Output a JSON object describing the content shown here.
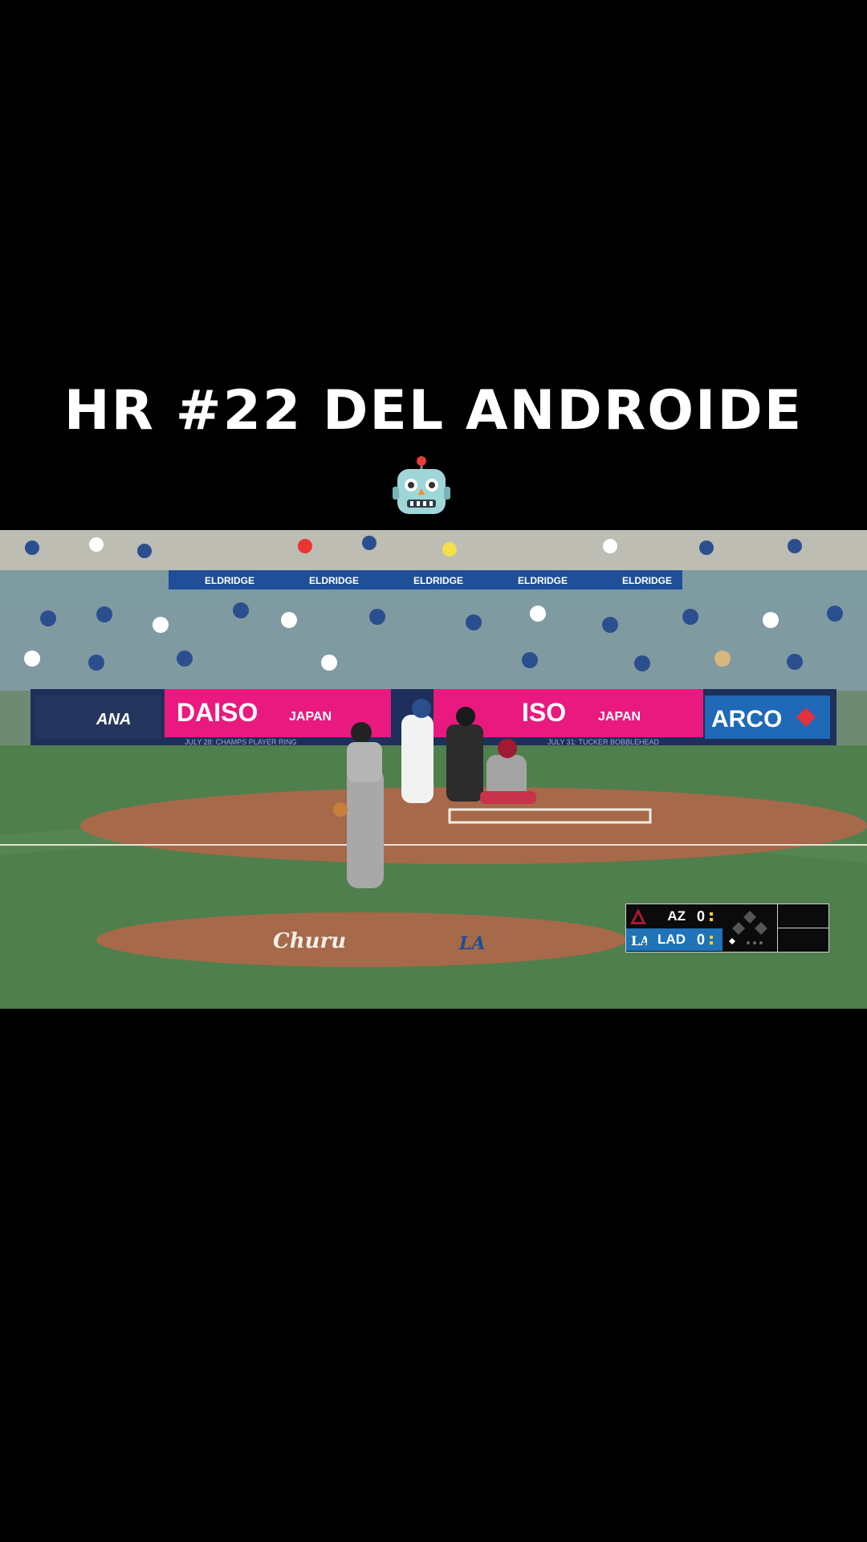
{
  "caption": {
    "title": "HR #22 DEL ANDROIDE",
    "emoji_icon": "robot-face-icon"
  },
  "broadcast": {
    "ads": {
      "eldridge": "ELDRIDGE",
      "ana": "ANA",
      "daiso_left": "DAISO",
      "daiso_left_sub": "JAPAN",
      "daiso_right": "ISO",
      "daiso_right_sub": "JAPAN",
      "arco": "ARCO",
      "promo_left": "JULY 28: CHAMPS PLAYER RING",
      "promo_right": "JULY 31: TUCKER BOBBLEHEAD",
      "mound_sponsor": "Churu",
      "mound_logo": "LA"
    },
    "colors": {
      "field_grass": "#4f7f4c",
      "dirt": "#a6694a",
      "daiso_pink": "#e9197f",
      "arco_blue": "#1f69b6",
      "wall_navy": "#1d2f5a",
      "scorebug_blue": "#1f73b8"
    }
  },
  "scorebug": {
    "away": {
      "team": "AZ",
      "score": "0"
    },
    "home": {
      "team": "LAD",
      "score": "0"
    },
    "outs_icon": "outs-dots-icon",
    "bases_icon": "bases-diamond-icon"
  }
}
